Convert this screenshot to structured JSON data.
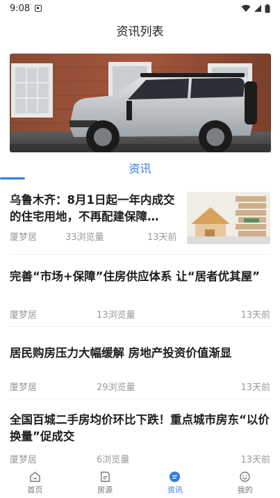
{
  "status_bar": {
    "time": "9:08"
  },
  "header": {
    "title": "资讯列表"
  },
  "tabs": [
    {
      "label": "资讯"
    }
  ],
  "news": [
    {
      "title": "乌鲁木齐：8月1日起一年内成交的住宅用地，不再配建保障…",
      "source": "厦梦居",
      "views": "33浏览量",
      "time": "13天前"
    },
    {
      "title": "完善“市场+保障”住房供应体系 让“居者优其屋”",
      "source": "厦梦居",
      "views": "13浏览量",
      "time": "13天前"
    },
    {
      "title": "居民购房压力大幅缓解 房地产投资价值渐显",
      "source": "厦梦居",
      "views": "29浏览量",
      "time": "13天前"
    },
    {
      "title": "全国百城二手房均价环比下跌！重点城市房东“以价换量”促成交",
      "source": "厦梦居",
      "views": "6浏览量",
      "time": "13天前"
    }
  ],
  "bottom_nav": [
    {
      "label": "首页",
      "icon": "home-icon"
    },
    {
      "label": "房源",
      "icon": "listing-icon"
    },
    {
      "label": "资讯",
      "icon": "news-icon"
    },
    {
      "label": "我的",
      "icon": "profile-icon"
    }
  ],
  "colors": {
    "accent": "#2f7de1",
    "muted": "#9a9a9a"
  }
}
